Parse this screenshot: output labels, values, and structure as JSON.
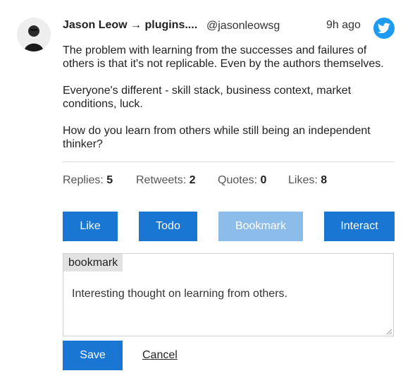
{
  "tweet": {
    "author": "Jason Leow → plugins....",
    "handle": "@jasonleowsg",
    "time": "9h ago",
    "paragraphs": [
      "The problem with learning from the successes and failures of others is that it's not replicable. Even by the authors themselves.",
      "Everyone's different - skill stack, business context, market conditions, luck.",
      "How do you learn from others while still being an independent thinker?"
    ]
  },
  "stats": {
    "replies_label": "Replies:",
    "replies": "5",
    "retweets_label": "Retweets:",
    "retweets": "2",
    "quotes_label": "Quotes:",
    "quotes": "0",
    "likes_label": "Likes:",
    "likes": "8"
  },
  "actions": {
    "like": "Like",
    "todo": "Todo",
    "bookmark": "Bookmark",
    "interact": "Interact"
  },
  "note": {
    "label": "bookmark",
    "text": "Interesting thought on learning from others."
  },
  "footer": {
    "save": "Save",
    "cancel": "Cancel"
  },
  "colors": {
    "primary": "#1976d2",
    "primary_disabled": "#8cbce9",
    "twitter": "#1d9bf0"
  },
  "icons": {
    "avatar": "profile-photo",
    "brand": "twitter-bird-icon"
  }
}
